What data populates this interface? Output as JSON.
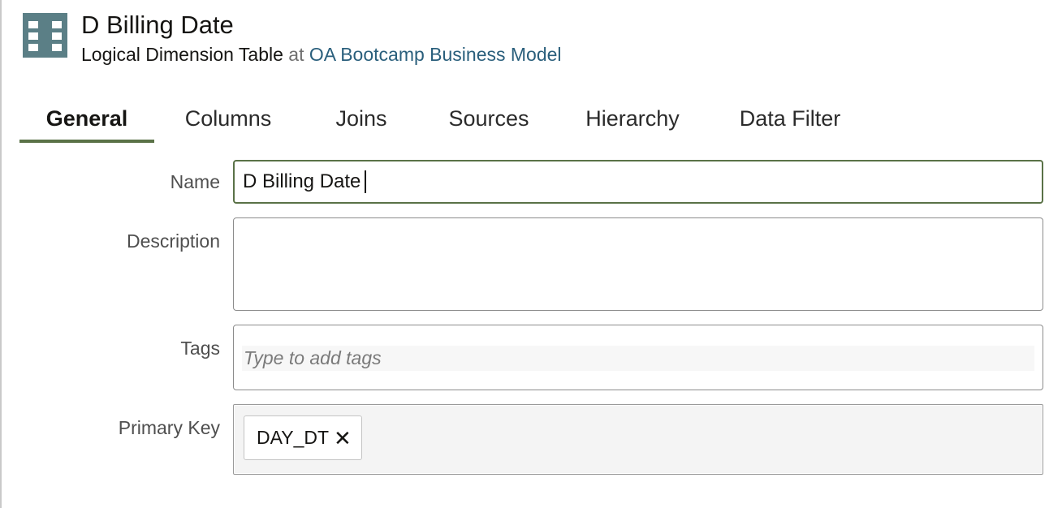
{
  "header": {
    "title": "D Billing Date",
    "object_type": "Logical Dimension Table",
    "at_text": "at",
    "parent_link": "OA Bootcamp Business Model",
    "icon": "dimension-table-icon",
    "icon_color": "#5b7f86"
  },
  "tabs": [
    {
      "label": "General",
      "active": true
    },
    {
      "label": "Columns",
      "active": false
    },
    {
      "label": "Joins",
      "active": false
    },
    {
      "label": "Sources",
      "active": false
    },
    {
      "label": "Hierarchy",
      "active": false
    },
    {
      "label": "Data Filter",
      "active": false
    }
  ],
  "form": {
    "name": {
      "label": "Name",
      "value": "D Billing Date"
    },
    "description": {
      "label": "Description",
      "value": ""
    },
    "tags": {
      "label": "Tags",
      "placeholder": "Type to add tags"
    },
    "primary_key": {
      "label": "Primary Key",
      "chips": [
        {
          "label": "DAY_DT",
          "remove_icon": "close-icon"
        }
      ]
    }
  },
  "colors": {
    "accent": "#5a7247",
    "link": "#2a5f7c"
  }
}
